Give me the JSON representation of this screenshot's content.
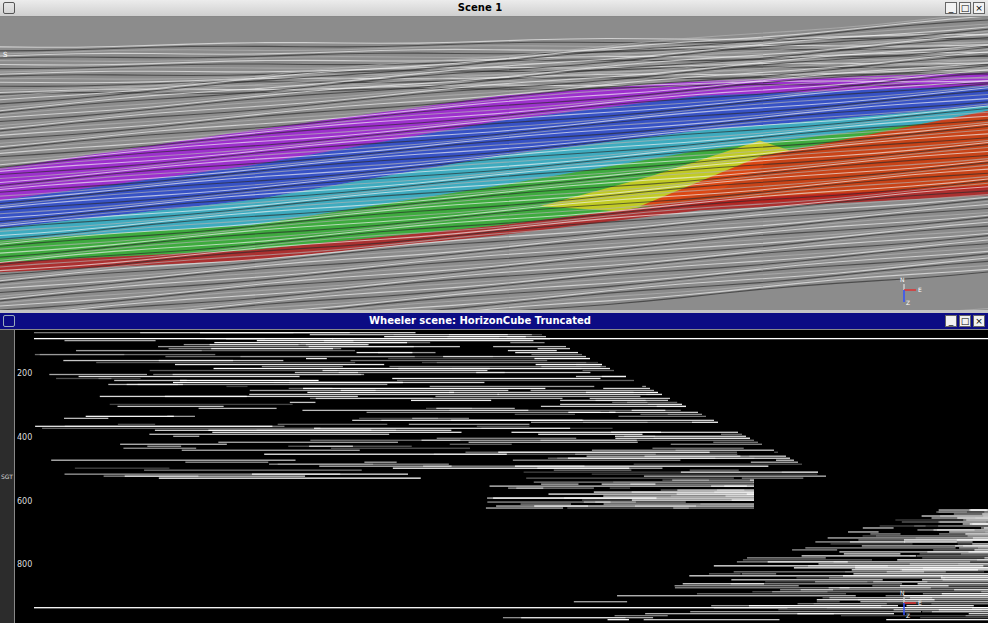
{
  "scene": {
    "title": "Scene 1",
    "active": false,
    "buttons": [
      "_",
      "□",
      "×"
    ],
    "marker": "S",
    "compass": {
      "north": "N",
      "east": "E",
      "depth": "Z"
    },
    "horizons": [
      {
        "color": "#a020d8"
      },
      {
        "color": "#2848d0"
      },
      {
        "color": "#30b0c8"
      },
      {
        "color": "#30b030"
      },
      {
        "color": "#d8d020"
      },
      {
        "color": "#e03010"
      },
      {
        "color": "#b02020"
      }
    ]
  },
  "wheeler": {
    "title": "Wheeler scene: HorizonCube Truncated",
    "active": true,
    "buttons": [
      "_",
      "□",
      "×"
    ],
    "axis": {
      "label": "SGT",
      "ticks": [
        "200",
        "400",
        "600",
        "800"
      ]
    },
    "compass": {
      "north": "N",
      "east": "E",
      "depth": "Z"
    }
  }
}
